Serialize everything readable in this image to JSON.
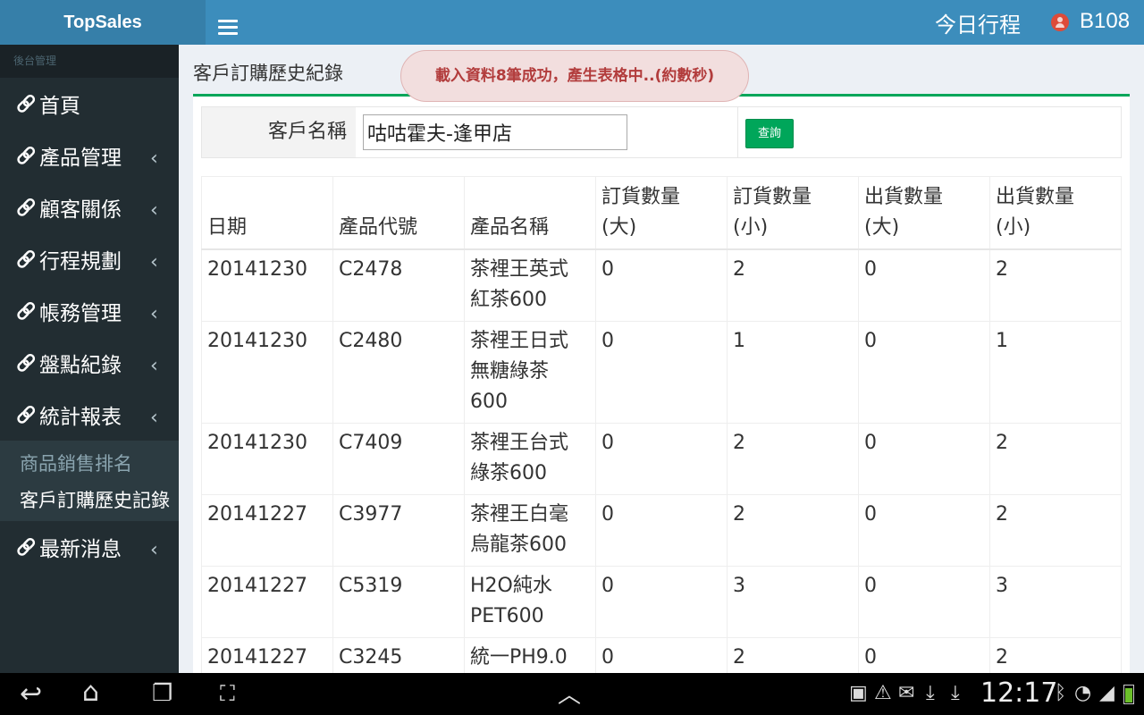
{
  "app": {
    "brand": "TopSales",
    "today_label": "今日行程",
    "user": "B108"
  },
  "sidebar": {
    "header": "後台管理",
    "items": [
      {
        "label": "首頁",
        "has_submenu": false
      },
      {
        "label": "產品管理",
        "has_submenu": true
      },
      {
        "label": "顧客關係",
        "has_submenu": true
      },
      {
        "label": "行程規劃",
        "has_submenu": true
      },
      {
        "label": "帳務管理",
        "has_submenu": true
      },
      {
        "label": "盤點紀錄",
        "has_submenu": true
      },
      {
        "label": "統計報表",
        "has_submenu": true,
        "expanded": true
      }
    ],
    "submenu": [
      {
        "label": "商品銷售排名",
        "active": false
      },
      {
        "label": "客戶訂購歷史記錄",
        "active": true
      }
    ],
    "last_item": {
      "label": "最新消息",
      "has_submenu": true
    }
  },
  "main": {
    "title": "客戶訂購歷史紀錄",
    "toast": "載入資料8筆成功，產生表格中..(約數秒)",
    "search": {
      "label": "客戶名稱",
      "value": "咕咕霍夫-逢甲店",
      "button": "查詢"
    },
    "table": {
      "headers": [
        [
          "日期"
        ],
        [
          "產品代號"
        ],
        [
          "產品名稱"
        ],
        [
          "訂貨數量",
          "(大)"
        ],
        [
          "訂貨數量",
          "(小)"
        ],
        [
          "出貨數量",
          "(大)"
        ],
        [
          "出貨數量",
          "(小)"
        ]
      ],
      "rows": [
        {
          "date": "20141230",
          "code": "C2478",
          "name": [
            "茶裡王英式",
            "紅茶600"
          ],
          "order_large": "0",
          "order_small": "2",
          "ship_large": "0",
          "ship_small": "2"
        },
        {
          "date": "20141230",
          "code": "C2480",
          "name": [
            "茶裡王日式",
            "無糖綠茶",
            "600"
          ],
          "order_large": "0",
          "order_small": "1",
          "ship_large": "0",
          "ship_small": "1"
        },
        {
          "date": "20141230",
          "code": "C7409",
          "name": [
            "茶裡王台式",
            "綠茶600"
          ],
          "order_large": "0",
          "order_small": "2",
          "ship_large": "0",
          "ship_small": "2"
        },
        {
          "date": "20141227",
          "code": "C3977",
          "name": [
            "茶裡王白毫",
            "烏龍茶600"
          ],
          "order_large": "0",
          "order_small": "2",
          "ship_large": "0",
          "ship_small": "2"
        },
        {
          "date": "20141227",
          "code": "C5319",
          "name": [
            "H2O純水",
            "PET600"
          ],
          "order_large": "0",
          "order_small": "3",
          "ship_large": "0",
          "ship_small": "3"
        },
        {
          "date": "20141227",
          "code": "C3245",
          "name": [
            "統一PH9.0"
          ],
          "order_large": "0",
          "order_small": "2",
          "ship_large": "0",
          "ship_small": "2"
        }
      ]
    }
  },
  "system_bar": {
    "clock": "12:17",
    "colors": {
      "battery": "#6bbf2a"
    }
  }
}
